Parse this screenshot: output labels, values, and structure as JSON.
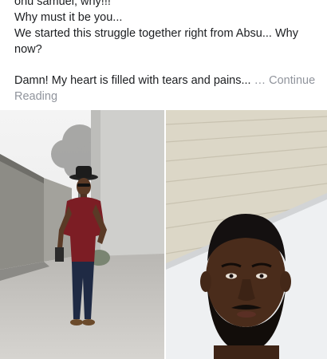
{
  "post": {
    "lines": [
      "onu samuel, why!!!",
      "Why must it be you...",
      "We started this struggle together right from Absu... Why now?",
      "Damn! My heart is filled with tears and pains...",
      "… Continue Reading"
    ]
  },
  "photos": [
    {
      "label": "man-standing-photo"
    },
    {
      "label": "man-selfie-photo"
    }
  ]
}
